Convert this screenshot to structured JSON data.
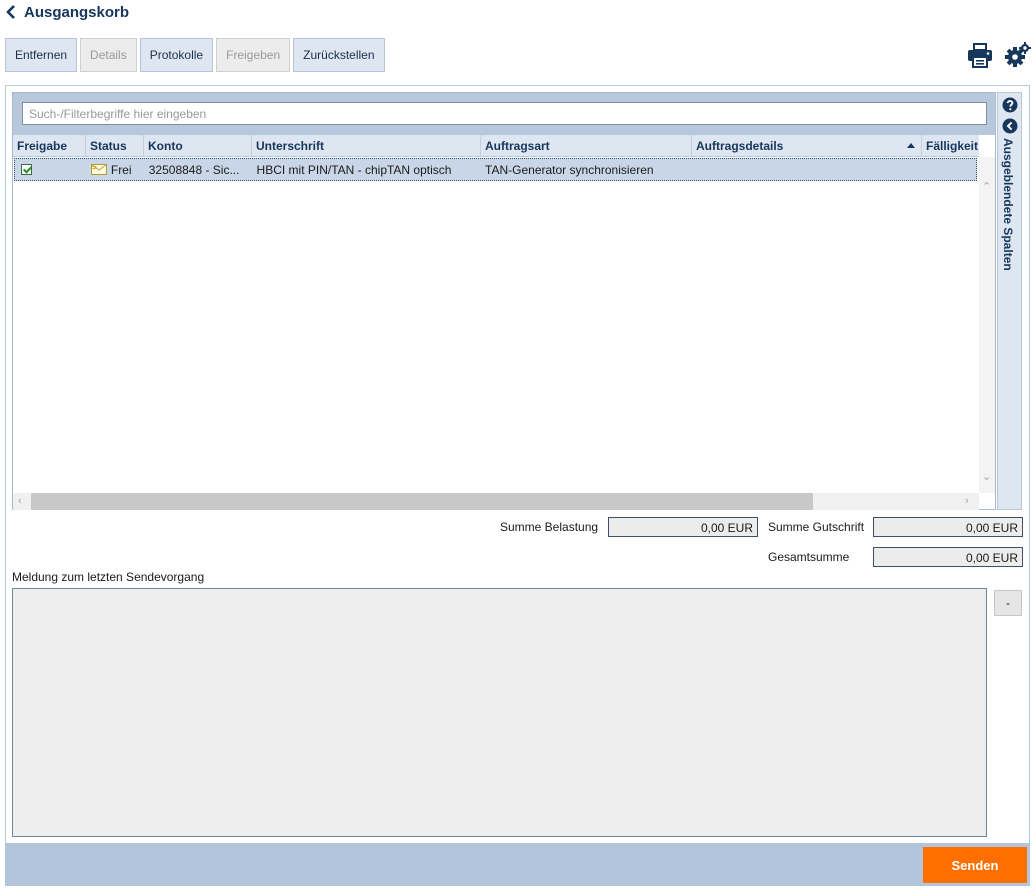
{
  "header": {
    "title": "Ausgangskorb"
  },
  "toolbar": {
    "buttons": [
      {
        "label": "Entfernen",
        "enabled": true
      },
      {
        "label": "Details",
        "enabled": false
      },
      {
        "label": "Protokolle",
        "enabled": true
      },
      {
        "label": "Freigeben",
        "enabled": false
      },
      {
        "label": "Zurückstellen",
        "enabled": true
      }
    ],
    "icons": [
      "print-icon",
      "gear-icon"
    ]
  },
  "search": {
    "placeholder": "Such-/Filterbegriffe hier eingeben",
    "value": ""
  },
  "table": {
    "columns": [
      "Freigabe",
      "Status",
      "Konto",
      "Unterschrift",
      "Auftragsart",
      "Auftragsdetails",
      "Fälligkeit"
    ],
    "sorted_column": "Auftragsdetails",
    "sort_direction": "ascending",
    "rows": [
      {
        "freigabe": true,
        "status": "Frei",
        "konto": "32508848 - Sic...",
        "unterschrift": "HBCI mit PIN/TAN - chipTAN optisch",
        "auftragsart": "TAN-Generator synchronisieren",
        "auftragsdetails": "",
        "faelligkeit": ""
      }
    ]
  },
  "side_panel": {
    "label": "Ausgeblendete Spalten"
  },
  "sums": {
    "belastung_label": "Summe Belastung",
    "belastung_value": "0,00 EUR",
    "gutschrift_label": "Summe Gutschrift",
    "gutschrift_value": "0,00 EUR",
    "gesamt_label": "Gesamtsumme",
    "gesamt_value": "0,00 EUR"
  },
  "message": {
    "label": "Meldung zum letzten Sendevorgang",
    "text": "",
    "collapse_label": "-"
  },
  "footer": {
    "send_label": "Senden"
  },
  "colors": {
    "accent": "#ff6f00",
    "header_blue": "#16365c",
    "toolbar_bg": "#dde6f1",
    "selection": "#c8d6e8"
  }
}
